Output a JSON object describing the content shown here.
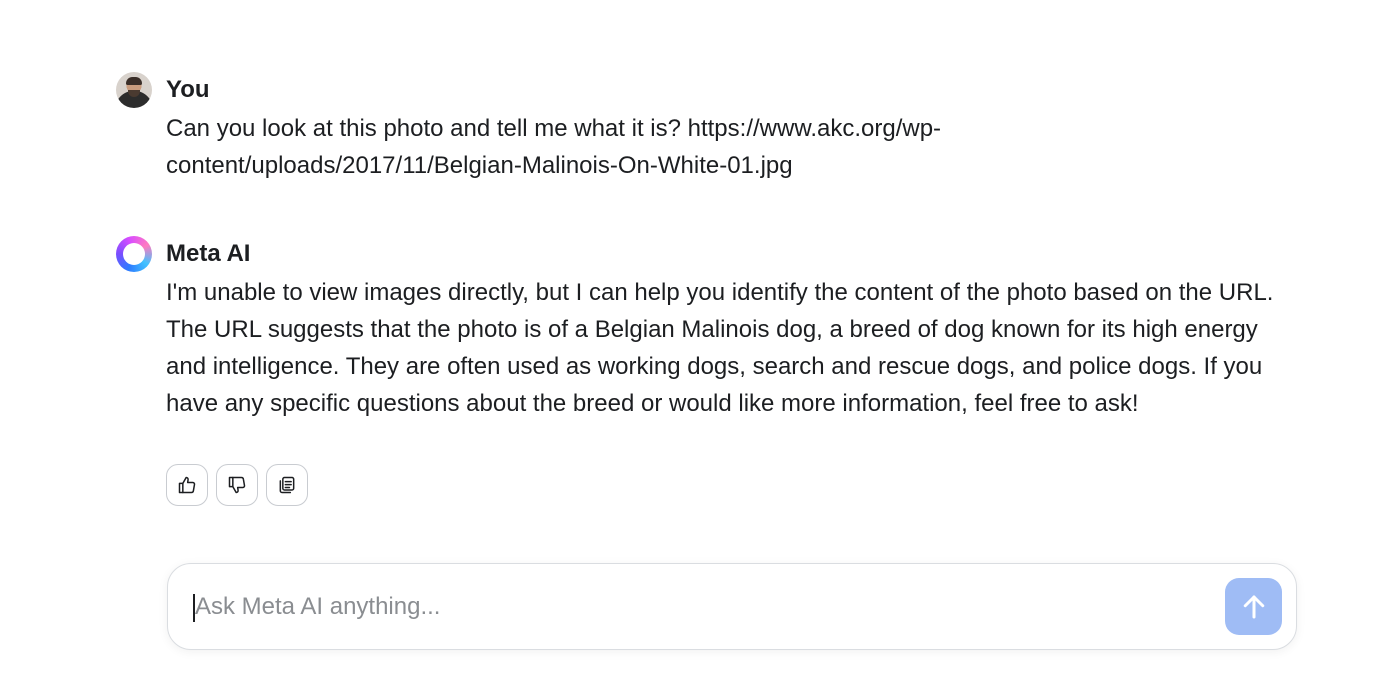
{
  "conversation": {
    "user_message": {
      "sender": "You",
      "text": "Can you look at this photo and tell me what it is? https://www.akc.org/wp-content/uploads/2017/11/Belgian-Malinois-On-White-01.jpg",
      "avatar_icon": "user-avatar"
    },
    "ai_message": {
      "sender": "Meta AI",
      "text": "I'm unable to view images directly, but I can help you identify the content of the photo based on the URL. The URL suggests that the photo is of a Belgian Malinois dog, a breed of dog known for its high energy and intelligence. They are often used as working dogs, search and rescue dogs, and police dogs. If you have any specific questions about the breed or would like more information, feel free to ask!",
      "avatar_icon": "meta-ai-ring-icon",
      "actions": [
        {
          "name": "thumbs-up",
          "icon": "thumbs-up-icon"
        },
        {
          "name": "thumbs-down",
          "icon": "thumbs-down-icon"
        },
        {
          "name": "copy",
          "icon": "copy-icon"
        }
      ]
    }
  },
  "composer": {
    "placeholder": "Ask Meta AI anything...",
    "value": "",
    "send_icon": "arrow-up-icon",
    "send_color": "#9fbcf5"
  }
}
